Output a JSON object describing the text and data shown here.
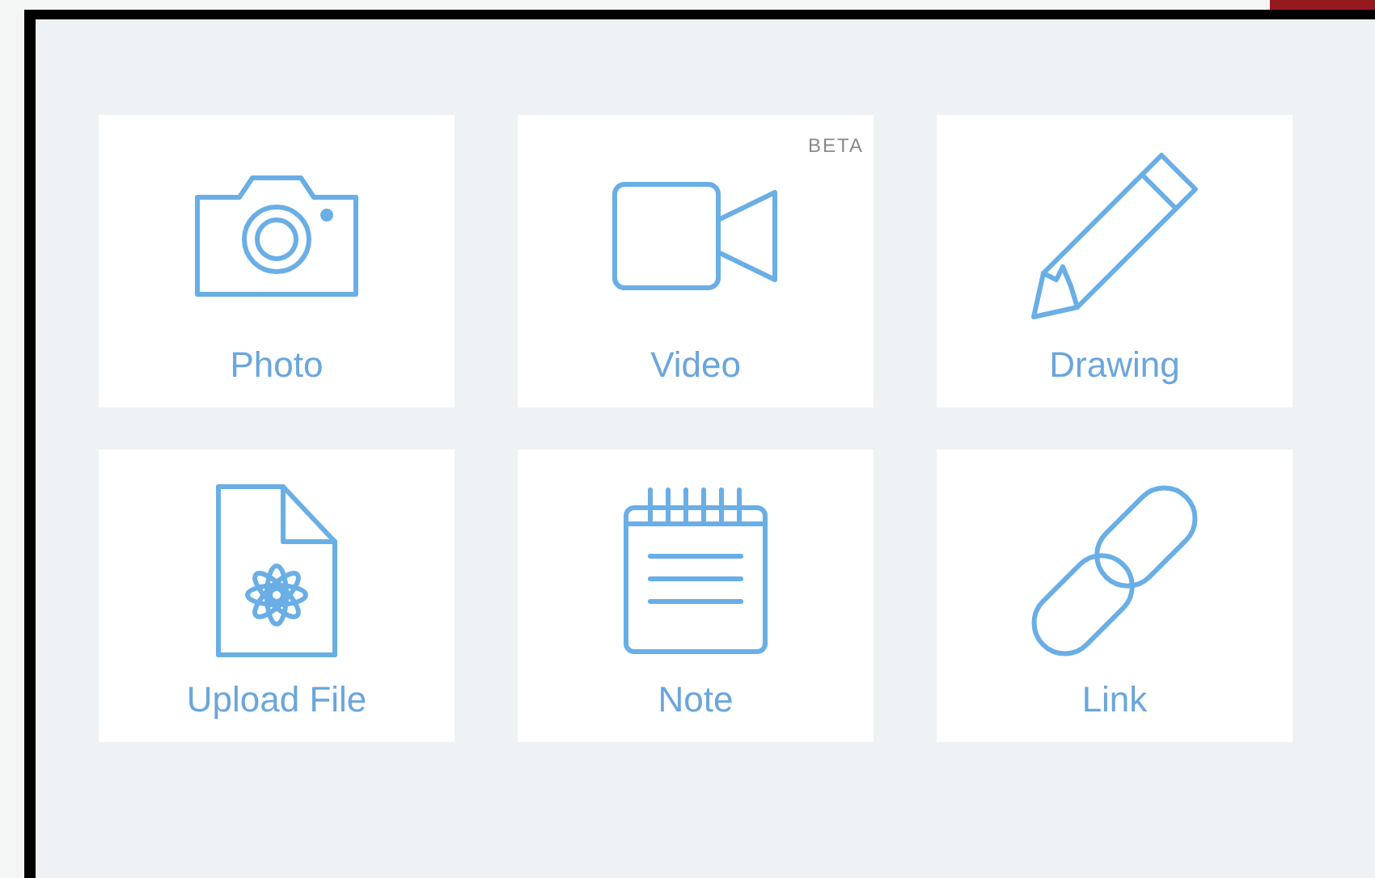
{
  "tiles": [
    {
      "kind": "camera",
      "label": "Photo"
    },
    {
      "kind": "video",
      "label": "Video",
      "badge": "BETA"
    },
    {
      "kind": "pencil",
      "label": "Drawing"
    },
    {
      "kind": "file",
      "label": "Upload File"
    },
    {
      "kind": "note",
      "label": "Note"
    },
    {
      "kind": "link",
      "label": "Link"
    }
  ]
}
